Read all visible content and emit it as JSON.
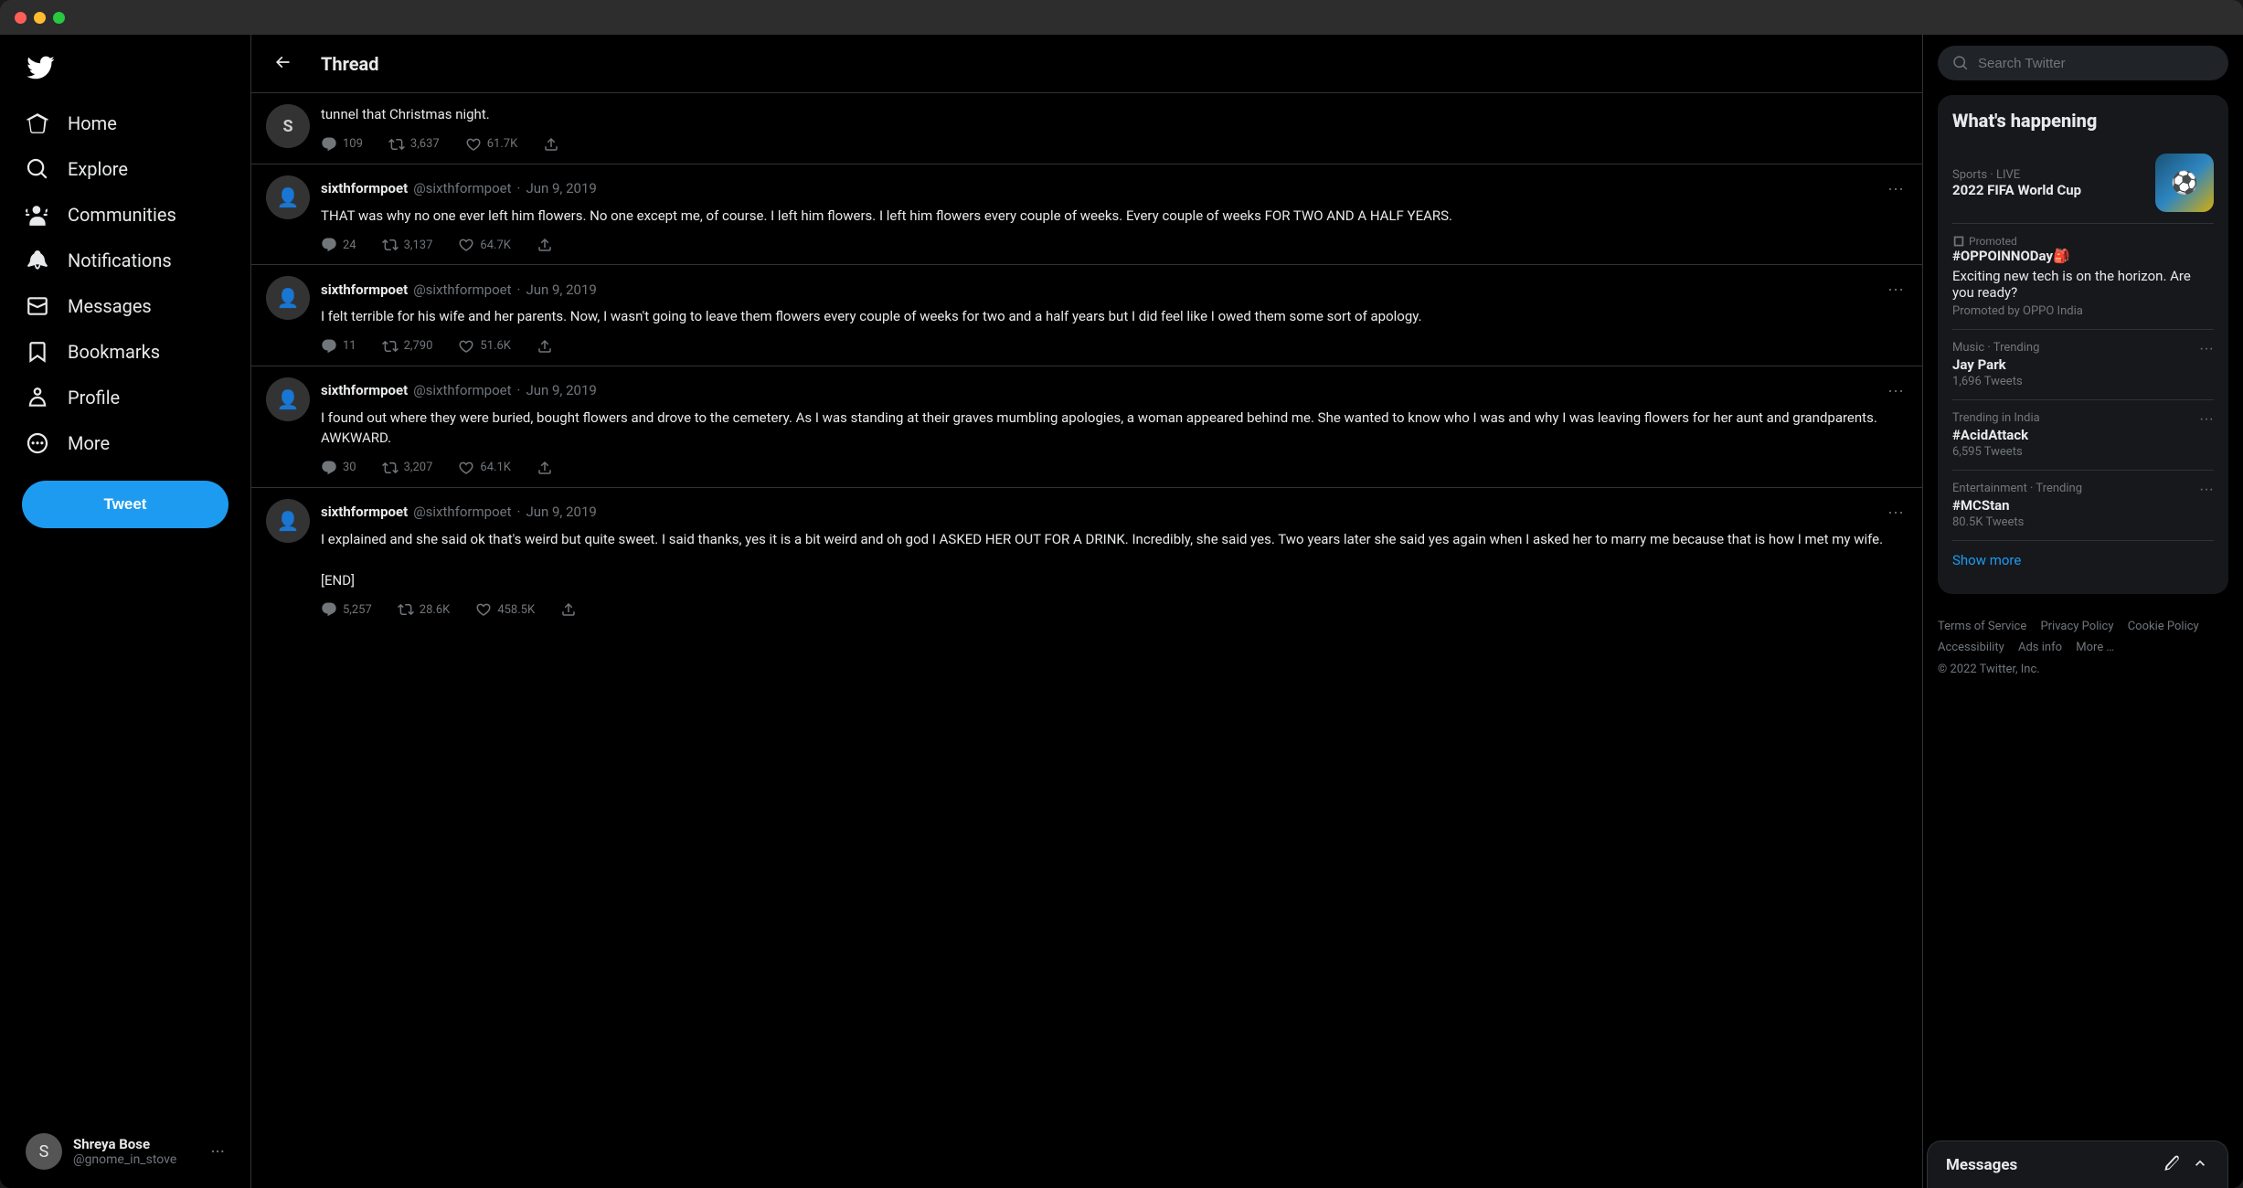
{
  "window": {
    "title": "Twitter"
  },
  "sidebar": {
    "logo_label": "Twitter logo",
    "nav_items": [
      {
        "id": "home",
        "label": "Home",
        "icon": "home"
      },
      {
        "id": "explore",
        "label": "Explore",
        "icon": "explore"
      },
      {
        "id": "communities",
        "label": "Communities",
        "icon": "communities"
      },
      {
        "id": "notifications",
        "label": "Notifications",
        "icon": "bell"
      },
      {
        "id": "messages",
        "label": "Messages",
        "icon": "mail"
      },
      {
        "id": "bookmarks",
        "label": "Bookmarks",
        "icon": "bookmark"
      },
      {
        "id": "profile",
        "label": "Profile",
        "icon": "person"
      },
      {
        "id": "more",
        "label": "More",
        "icon": "more"
      }
    ],
    "tweet_button_label": "Tweet",
    "user": {
      "name": "Shreya Bose",
      "handle": "@gnome_in_stove",
      "avatar_letter": "S"
    }
  },
  "thread": {
    "header_title": "Thread",
    "partial_tweet_text": "tunnel that Christmas night.",
    "tweets": [
      {
        "id": "t0",
        "author_name": "",
        "author_handle": "",
        "date": "",
        "text": "tunnel that Christmas night.",
        "actions": {
          "replies": "109",
          "retweets": "3,637",
          "likes": "61.7K"
        }
      },
      {
        "id": "t1",
        "author_name": "sixthformpoet",
        "author_handle": "@sixthformpoet",
        "date": "Jun 9, 2019",
        "text": "THAT was why no one ever left him flowers. No one except me, of course. I left him flowers. I left him flowers every couple of weeks. Every couple of weeks FOR TWO AND A HALF YEARS.",
        "actions": {
          "replies": "24",
          "retweets": "3,137",
          "likes": "64.7K"
        }
      },
      {
        "id": "t2",
        "author_name": "sixthformpoet",
        "author_handle": "@sixthformpoet",
        "date": "Jun 9, 2019",
        "text": "I felt terrible for his wife and her parents. Now, I wasn't going to leave them flowers every couple of weeks for two and a half years but I did feel like I owed them some sort of apology.",
        "actions": {
          "replies": "11",
          "retweets": "2,790",
          "likes": "51.6K"
        }
      },
      {
        "id": "t3",
        "author_name": "sixthformpoet",
        "author_handle": "@sixthformpoet",
        "date": "Jun 9, 2019",
        "text": "I found out where they were buried, bought flowers and drove to the cemetery. As I was standing at their graves mumbling apologies, a woman appeared behind me. She wanted to know who I was and why I was leaving flowers for her aunt and grandparents. AWKWARD.",
        "actions": {
          "replies": "30",
          "retweets": "3,207",
          "likes": "64.1K"
        }
      },
      {
        "id": "t4",
        "author_name": "sixthformpoet",
        "author_handle": "@sixthformpoet",
        "date": "Jun 9, 2019",
        "text": "I explained and she said ok that's weird but quite sweet. I said thanks, yes it is a bit weird and oh god I ASKED HER OUT FOR A DRINK. Incredibly, she said yes. Two years later she said yes again when I asked her to marry me because that is how I met my wife.\n\n[END]",
        "actions": {
          "replies": "5,257",
          "retweets": "28.6K",
          "likes": "458.5K"
        }
      }
    ]
  },
  "right_sidebar": {
    "search_placeholder": "Search Twitter",
    "whats_happening_title": "What's happening",
    "trending": {
      "fifa": {
        "category": "Sports · LIVE",
        "title": "2022 FIFA World Cup",
        "emoji": "⚽"
      },
      "promo": {
        "badge": "Promoted",
        "name": "#OPPOINNODay🎒",
        "description": "Exciting new tech is on the horizon. Are you ready?",
        "by": "Promoted by OPPO India"
      },
      "items": [
        {
          "category": "Music · Trending",
          "name": "Jay Park",
          "count": "1,696 Tweets",
          "has_more": true
        },
        {
          "category": "Trending in India",
          "name": "#AcidAttack",
          "count": "6,595 Tweets",
          "has_more": true
        },
        {
          "category": "Entertainment · Trending",
          "name": "#MCStan",
          "count": "80.5K Tweets",
          "has_more": true
        }
      ],
      "show_more": "Show more"
    },
    "footer": {
      "links": [
        "Terms of Service",
        "Privacy Policy",
        "Cookie Policy",
        "Accessibility",
        "Ads info",
        "More …"
      ],
      "copyright": "© 2022 Twitter, Inc."
    }
  },
  "messages_bar": {
    "title": "Messages"
  }
}
